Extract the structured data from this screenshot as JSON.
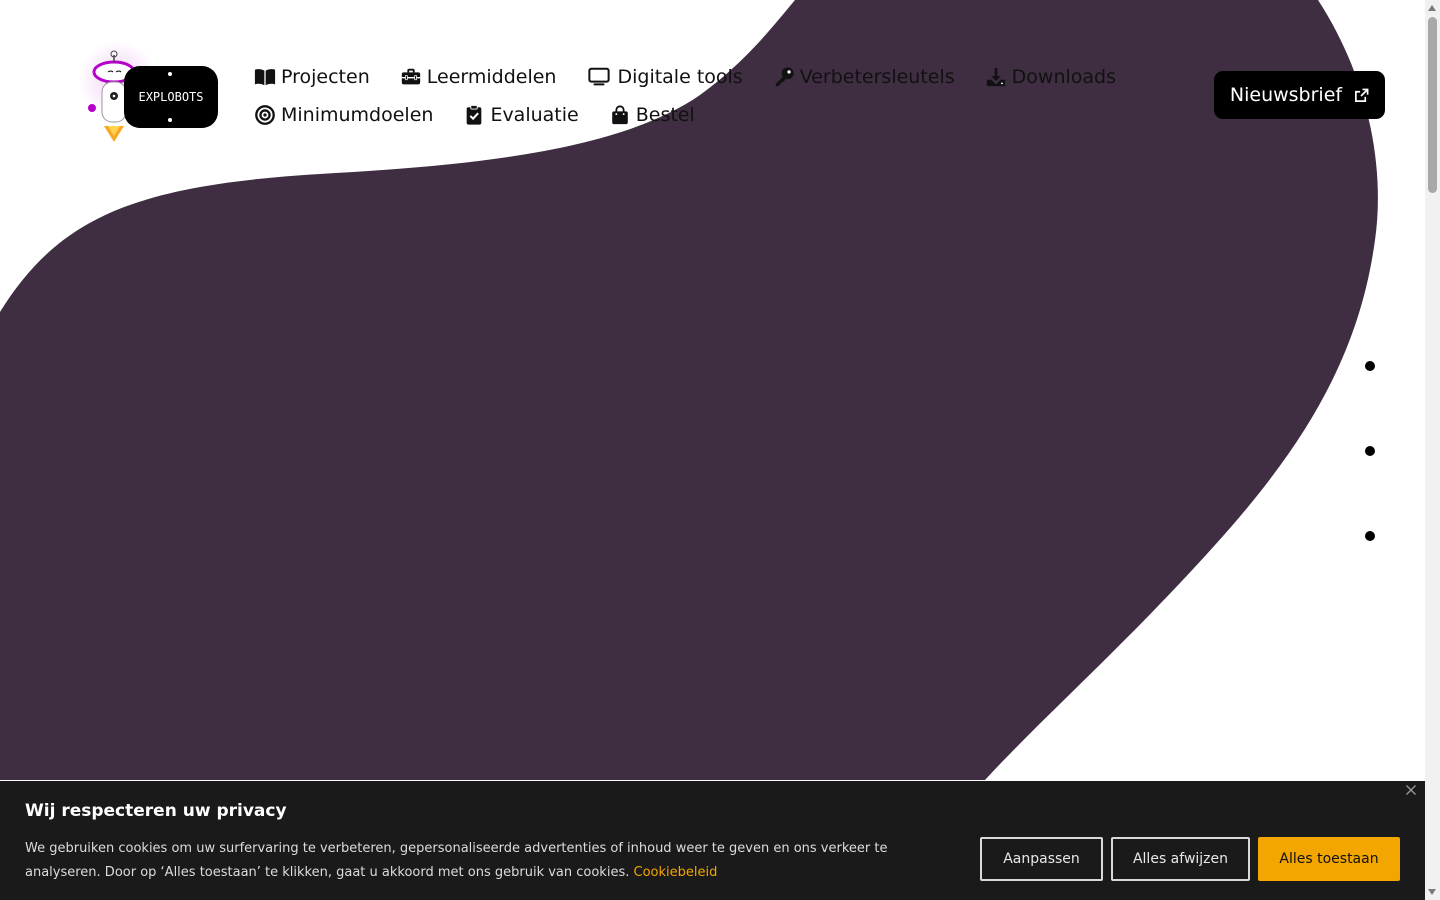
{
  "brand": {
    "name": "EXPLOBOTS"
  },
  "nav": {
    "row1": [
      {
        "label": "Projecten",
        "icon": "book-open-icon"
      },
      {
        "label": "Leermiddelen",
        "icon": "toolbox-icon"
      },
      {
        "label": "Digitale tools",
        "icon": "monitor-icon"
      },
      {
        "label": "Verbetersleutels",
        "icon": "key-icon"
      },
      {
        "label": "Downloads",
        "icon": "download-icon"
      }
    ],
    "row2": [
      {
        "label": "Minimumdoelen",
        "icon": "target-icon"
      },
      {
        "label": "Evaluatie",
        "icon": "clipboard-check-icon"
      },
      {
        "label": "Bestel",
        "icon": "shopping-bag-icon"
      }
    ]
  },
  "newsletter": {
    "label": "Nieuwsbrief",
    "icon": "external-link-icon"
  },
  "slider": {
    "dot_count": 3
  },
  "cookie": {
    "title": "Wij respecteren uw privacy",
    "text": "We gebruiken cookies om uw surfervaring te verbeteren, gepersonaliseerde advertenties of inhoud weer te geven en ons verkeer te analyseren. Door op ‘Alles toestaan’ te klikken, gaat u akkoord met ons gebruik van cookies.",
    "link": "Cookiebeleid",
    "buttons": {
      "customize": "Aanpassen",
      "reject": "Alles afwijzen",
      "accept": "Alles toestaan"
    }
  },
  "colors": {
    "blob": "#3f2d42",
    "accent": "#f3a600",
    "banner_bg": "#1a1a1a"
  }
}
